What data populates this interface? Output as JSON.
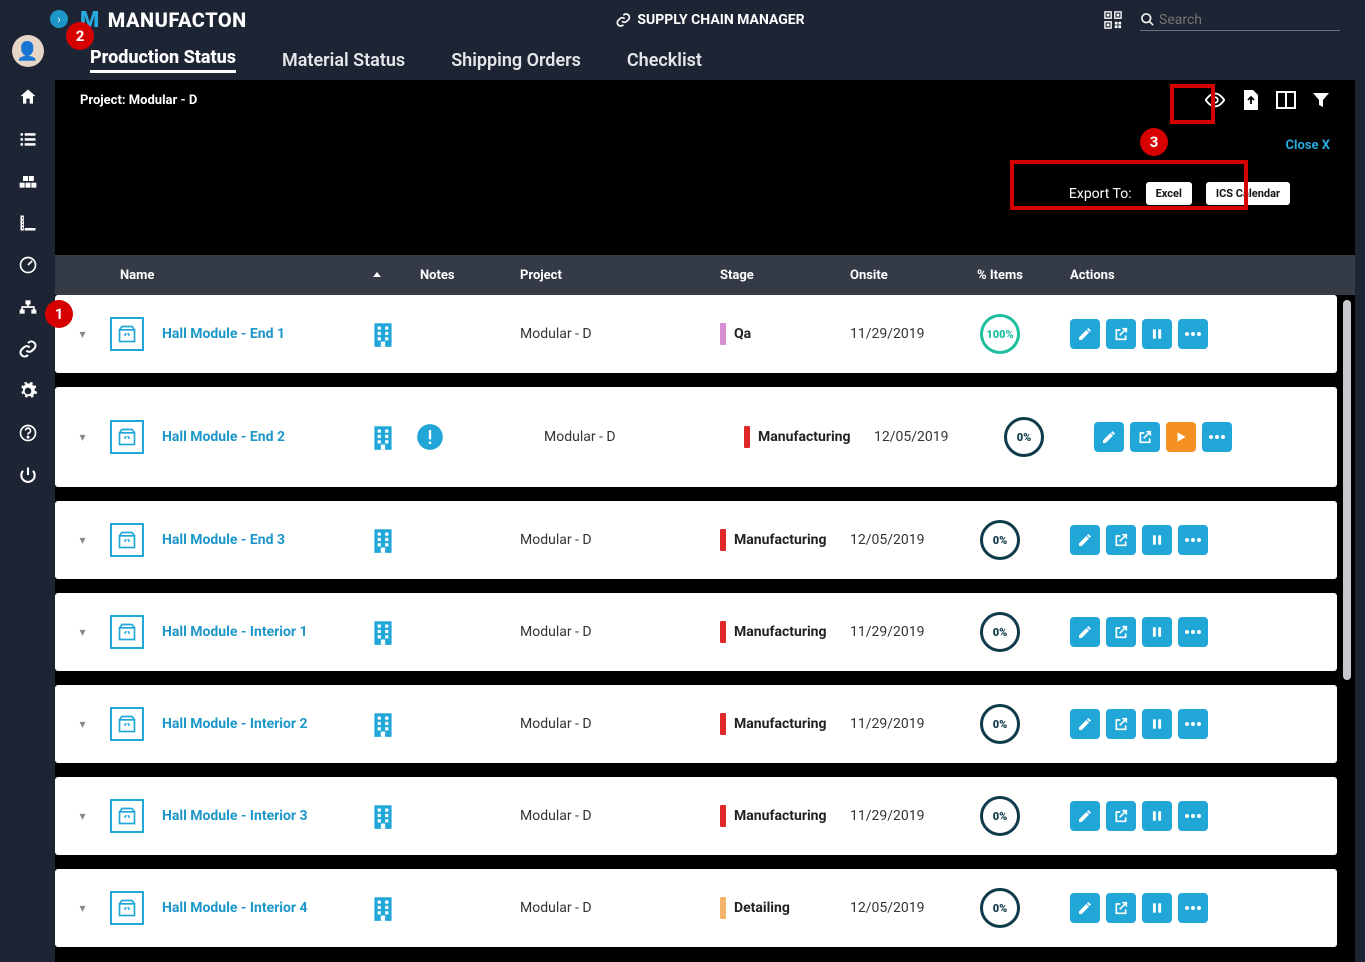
{
  "app": {
    "brand": "MANUFACTON",
    "module": "SUPPLY CHAIN MANAGER"
  },
  "search": {
    "placeholder": "Search"
  },
  "tabs": [
    "Production Status",
    "Material Status",
    "Shipping Orders",
    "Checklist"
  ],
  "project": {
    "label": "Project:",
    "name": "Modular - D"
  },
  "export": {
    "close": "Close X",
    "label": "Export To:",
    "excel": "Excel",
    "ics": "ICS Calendar"
  },
  "columns": {
    "name": "Name",
    "notes": "Notes",
    "project": "Project",
    "stage": "Stage",
    "onsite": "Onsite",
    "items": "% Items",
    "actions": "Actions"
  },
  "callouts": {
    "b1": "1",
    "b2": "2",
    "b3": "3"
  },
  "rows": [
    {
      "name": "Hall Module - End 1",
      "project": "Modular - D",
      "stage": "Qa",
      "stageColor": "#d88fd1",
      "onsite": "11/29/2019",
      "pct": "100%",
      "full": true,
      "alert": false,
      "play": false
    },
    {
      "name": "Hall Module - End 2",
      "project": "Modular - D",
      "stage": "Manufacturing",
      "stageColor": "#e02829",
      "onsite": "12/05/2019",
      "pct": "0%",
      "full": false,
      "alert": true,
      "play": true
    },
    {
      "name": "Hall Module - End 3",
      "project": "Modular - D",
      "stage": "Manufacturing",
      "stageColor": "#e02829",
      "onsite": "12/05/2019",
      "pct": "0%",
      "full": false,
      "alert": false,
      "play": false
    },
    {
      "name": "Hall Module - Interior 1",
      "project": "Modular - D",
      "stage": "Manufacturing",
      "stageColor": "#e02829",
      "onsite": "11/29/2019",
      "pct": "0%",
      "full": false,
      "alert": false,
      "play": false
    },
    {
      "name": "Hall Module - Interior 2",
      "project": "Modular - D",
      "stage": "Manufacturing",
      "stageColor": "#e02829",
      "onsite": "11/29/2019",
      "pct": "0%",
      "full": false,
      "alert": false,
      "play": false
    },
    {
      "name": "Hall Module - Interior 3",
      "project": "Modular - D",
      "stage": "Manufacturing",
      "stageColor": "#e02829",
      "onsite": "11/29/2019",
      "pct": "0%",
      "full": false,
      "alert": false,
      "play": false
    },
    {
      "name": "Hall Module - Interior 4",
      "project": "Modular - D",
      "stage": "Detailing",
      "stageColor": "#f2b26b",
      "onsite": "12/05/2019",
      "pct": "0%",
      "full": false,
      "alert": false,
      "play": false
    }
  ]
}
